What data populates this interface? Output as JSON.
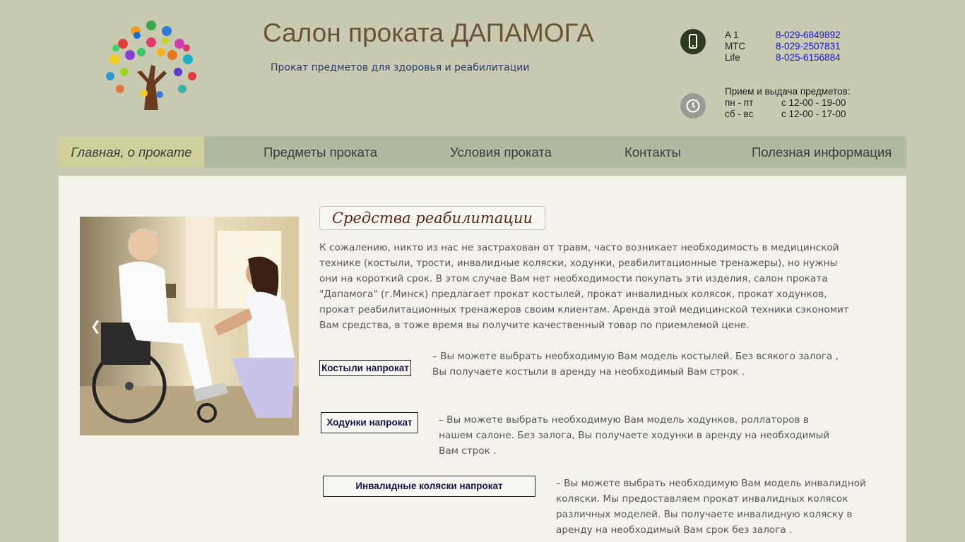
{
  "header": {
    "title": "Салон проката ДАПАМОГА",
    "subtitle": "Прокат предметов для здоровья и реабилитации",
    "phones": [
      {
        "operator": "A 1",
        "number": "8-029-6849892"
      },
      {
        "operator": "MTC",
        "number": "8-029-2507831"
      },
      {
        "operator": "Life",
        "number": "8-025-6156884"
      }
    ],
    "hours": {
      "heading": "Прием и выдача предметов:",
      "rows": [
        {
          "days": "пн - пт",
          "time": "с 12-00 - 19-00"
        },
        {
          "days": "сб - вс",
          "time": "с 12-00 - 17-00"
        }
      ]
    }
  },
  "nav": {
    "items": [
      {
        "label": "Главная, о прокате"
      },
      {
        "label": "Предметы проката"
      },
      {
        "label": "Условия проката"
      },
      {
        "label": "Контакты"
      },
      {
        "label": "Полезная информация"
      }
    ]
  },
  "main": {
    "section_title": "Средства реабилитации",
    "intro": "К сожалению, никто из нас не застрахован от травм, часто возникает необходимость в медицинской технике  (костыли,  трости,  инвалидные коляски, ходунки, реабилитационные тренажеры), но нужны они на короткий срок. В этом случае Вам нет необходимости покупать эти изделия, салон проката \"Дапамога\" (г.Минск) предлагает прокат костылей, прокат инвалидных колясок, прокат ходунков, прокат реабилитационных тренажеров  своим клиентам. Аренда этой медицинской техники сэкономит Вам средства, в тоже время вы получите качественный товар по приемлемой цене.",
    "categories": [
      {
        "button": "Костыли напрокат",
        "text": " – Вы можете выбрать необходимую Вам модель костылей. Без всякого залога , Вы получаете костыли в аренду на необходимый Вам строк ."
      },
      {
        "button": "Ходунки напрокат",
        "text": " – Вы можете выбрать необходимую Вам модель ходунков, роллаторов в нашем салоне. Без залога, Вы получаете ходунки в аренду на необходимый Вам строк ."
      },
      {
        "button": "Инвалидные коляски напрокат",
        "text": " – Вы можете выбрать необходимую Вам модель инвалидной коляски. Мы предоставляем прокат инвалидных колясок различных моделей. Вы получаете инвалидную коляску в аренду на необходимый Вам срок без залога ."
      }
    ]
  },
  "slider": {
    "prev_icon": "chevron-left-icon",
    "next_icon": "chevron-right-icon"
  }
}
